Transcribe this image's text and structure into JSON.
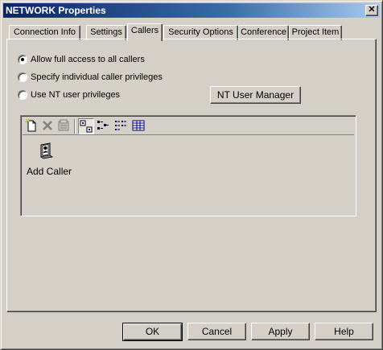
{
  "window": {
    "title": "NETWORK Properties",
    "close_glyph": "✕"
  },
  "tabs": [
    {
      "label": "Connection Info",
      "active": false
    },
    {
      "label": "Settings",
      "active": false
    },
    {
      "label": "Callers",
      "active": true
    },
    {
      "label": "Security Options",
      "active": false
    },
    {
      "label": "Conference",
      "active": false
    },
    {
      "label": "Project Item",
      "active": false
    }
  ],
  "access": {
    "options": [
      {
        "label": "Allow full access to all callers",
        "selected": true
      },
      {
        "label": "Specify individual caller privileges",
        "selected": false
      },
      {
        "label": "Use NT user privileges",
        "selected": false
      }
    ],
    "nt_user_manager_label": "NT User Manager"
  },
  "toolbar": {
    "icons": [
      "new-item-icon",
      "delete-icon",
      "properties-icon",
      "large-icons-view-icon",
      "small-icons-view-icon",
      "list-view-icon",
      "details-view-icon"
    ]
  },
  "callers_list": {
    "items": [
      {
        "label": "Add Caller",
        "icon": "add-caller-icon"
      }
    ]
  },
  "footer": {
    "ok_label": "OK",
    "cancel_label": "Cancel",
    "apply_label": "Apply",
    "help_label": "Help"
  }
}
